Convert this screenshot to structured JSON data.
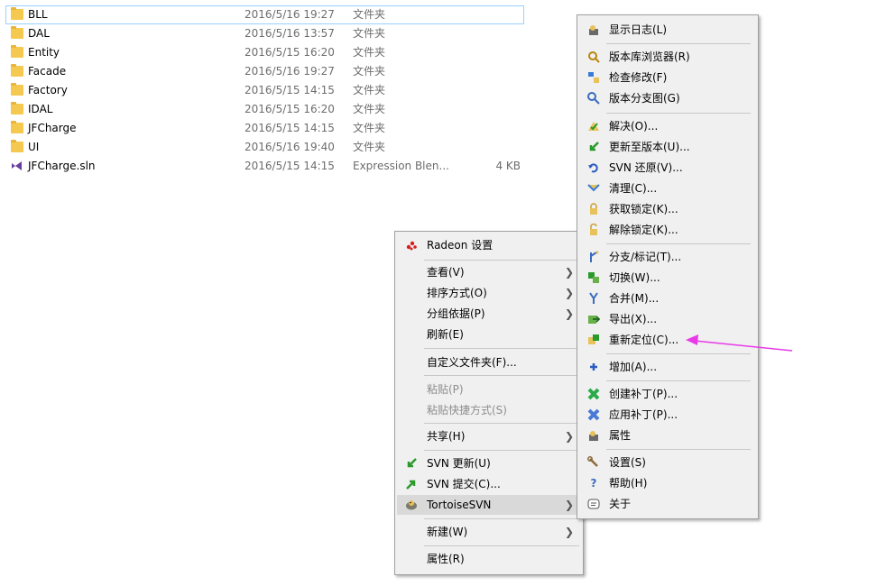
{
  "files": [
    {
      "name": "BLL",
      "date": "2016/5/16 19:27",
      "type": "文件夹",
      "size": "",
      "icon": "folder-icon",
      "selected": true
    },
    {
      "name": "DAL",
      "date": "2016/5/16 13:57",
      "type": "文件夹",
      "size": "",
      "icon": "folder-icon"
    },
    {
      "name": "Entity",
      "date": "2016/5/15 16:20",
      "type": "文件夹",
      "size": "",
      "icon": "folder-icon"
    },
    {
      "name": "Facade",
      "date": "2016/5/16 19:27",
      "type": "文件夹",
      "size": "",
      "icon": "folder-icon"
    },
    {
      "name": "Factory",
      "date": "2016/5/15 14:15",
      "type": "文件夹",
      "size": "",
      "icon": "folder-icon"
    },
    {
      "name": "IDAL",
      "date": "2016/5/15 16:20",
      "type": "文件夹",
      "size": "",
      "icon": "folder-icon"
    },
    {
      "name": "JFCharge",
      "date": "2016/5/15 14:15",
      "type": "文件夹",
      "size": "",
      "icon": "folder-icon"
    },
    {
      "name": "UI",
      "date": "2016/5/16 19:40",
      "type": "文件夹",
      "size": "",
      "icon": "folder-icon"
    },
    {
      "name": "JFCharge.sln",
      "date": "2016/5/15 14:15",
      "type": "Expression Blen...",
      "size": "4 KB",
      "icon": "visual-studio-solution-icon"
    }
  ],
  "context_menu": {
    "radeon": "Radeon 设置",
    "view": "查看(V)",
    "sort": "排序方式(O)",
    "group": "分组依据(P)",
    "refresh": "刷新(E)",
    "customize": "自定义文件夹(F)...",
    "paste": "粘贴(P)",
    "paste_shortcut": "粘贴快捷方式(S)",
    "share": "共享(H)",
    "svn_update": "SVN 更新(U)",
    "svn_commit": "SVN 提交(C)...",
    "tortoise": "TortoiseSVN",
    "new": "新建(W)",
    "properties": "属性(R)"
  },
  "svn_menu": {
    "show_log": "显示日志(L)",
    "repo_browser": "版本库浏览器(R)",
    "check_mods": "检查修改(F)",
    "revision_graph": "版本分支图(G)",
    "resolve": "解决(O)...",
    "update_rev": "更新至版本(U)...",
    "revert": "SVN 还原(V)...",
    "cleanup": "清理(C)...",
    "get_lock": "获取锁定(K)...",
    "release_lock": "解除锁定(K)...",
    "branch_tag": "分支/标记(T)...",
    "switch": "切换(W)...",
    "merge": "合并(M)...",
    "export": "导出(X)...",
    "relocate": "重新定位(C)...",
    "add": "增加(A)...",
    "create_patch": "创建补丁(P)...",
    "apply_patch": "应用补丁(P)...",
    "properties": "属性",
    "settings": "设置(S)",
    "help": "帮助(H)",
    "about": "关于"
  },
  "colors": {
    "annotation_arrow": "#e83ae8",
    "selection_border": "#99d1ff",
    "menu_bg": "#f0f0f0",
    "hover_bg": "#d9d9d9"
  }
}
